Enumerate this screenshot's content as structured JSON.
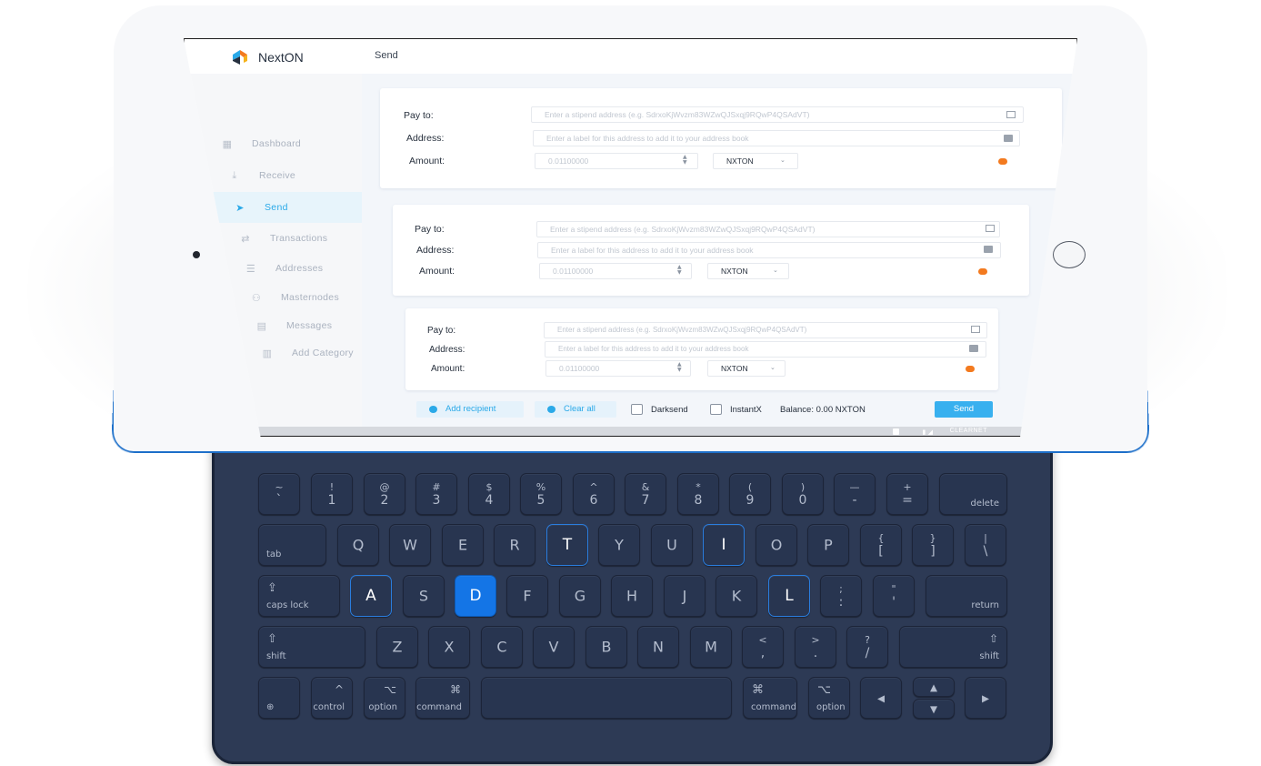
{
  "app": {
    "brand": "NextON",
    "page_title": "Send"
  },
  "sidebar": {
    "items": [
      {
        "label": "Dashboard",
        "icon": "grid-icon"
      },
      {
        "label": "Receive",
        "icon": "download-icon"
      },
      {
        "label": "Send",
        "icon": "paper-plane-icon",
        "active": true
      },
      {
        "label": "Transactions",
        "icon": "transfer-icon"
      },
      {
        "label": "Addresses",
        "icon": "contacts-icon"
      },
      {
        "label": "Masternodes",
        "icon": "nodes-icon"
      },
      {
        "label": "Messages",
        "icon": "chat-icon"
      },
      {
        "label": "Add Category",
        "icon": "chart-icon"
      }
    ]
  },
  "recipients": [
    {
      "pay_to_label": "Pay to:",
      "pay_to_placeholder": "Enter a stipend address (e.g. SdrxoKjWvzm83WZwQJSxqj9RQwP4QSAdVT)",
      "address_label": "Address:",
      "address_placeholder": "Enter a label for this address to add it to your address book",
      "amount_label": "Amount:",
      "amount_value": "0.01100000",
      "unit": "NXTON"
    },
    {
      "pay_to_label": "Pay to:",
      "pay_to_placeholder": "Enter a stipend address (e.g. SdrxoKjWvzm83WZwQJSxqj9RQwP4QSAdVT)",
      "address_label": "Address:",
      "address_placeholder": "Enter a label for this address to add it to your address book",
      "amount_label": "Amount:",
      "amount_value": "0.01100000",
      "unit": "NXTON"
    },
    {
      "pay_to_label": "Pay to:",
      "pay_to_placeholder": "Enter a stipend address (e.g. SdrxoKjWvzm83WZwQJSxqj9RQwP4QSAdVT)",
      "address_label": "Address:",
      "address_placeholder": "Enter a label for this address to add it to your address book",
      "amount_label": "Amount:",
      "amount_value": "0.01100000",
      "unit": "NXTON"
    }
  ],
  "footer": {
    "add_recipient": "Add recipient",
    "clear_all": "Clear all",
    "darksend": "Darksend",
    "instantx": "InstantX",
    "balance": "Balance: 0.00 NXTON",
    "send": "Send"
  },
  "statusbar": {
    "network": "CLEARNET"
  },
  "colors": {
    "accent": "#2aa9e8",
    "remove": "#f37a1f",
    "tablet": "#2a82dc",
    "keyboard": "#2d3a55",
    "key_highlight": "#1475e6"
  },
  "keyboard": {
    "row1": [
      {
        "t": "~",
        "b": "`"
      },
      {
        "t": "!",
        "b": "1"
      },
      {
        "t": "@",
        "b": "2"
      },
      {
        "t": "#",
        "b": "3"
      },
      {
        "t": "$",
        "b": "4"
      },
      {
        "t": "%",
        "b": "5"
      },
      {
        "t": "^",
        "b": "6"
      },
      {
        "t": "&",
        "b": "7"
      },
      {
        "t": "*",
        "b": "8"
      },
      {
        "t": "(",
        "b": "9"
      },
      {
        "t": ")",
        "b": "0"
      },
      {
        "t": "—",
        "b": "-"
      },
      {
        "t": "+",
        "b": "="
      },
      {
        "label": "delete"
      }
    ],
    "row2": [
      "tab",
      "Q",
      "W",
      "E",
      "R",
      "T",
      "Y",
      "U",
      "I",
      "O",
      "P",
      "{ [",
      "} ]",
      "| \\"
    ],
    "row3": [
      "caps lock",
      "A",
      "S",
      "D",
      "F",
      "G",
      "H",
      "J",
      "K",
      "L",
      "; :",
      "\" '",
      "return"
    ],
    "row4": [
      "shift",
      "Z",
      "X",
      "C",
      "V",
      "B",
      "N",
      "M",
      "< ,",
      "> .",
      "? /",
      "shift"
    ],
    "mods": {
      "globe": "globe-icon",
      "control": "control",
      "option": "option",
      "command": "command",
      "command_right": "command",
      "option_right": "option"
    },
    "highlighted": [
      "T",
      "I",
      "A",
      "L"
    ],
    "active": "D"
  }
}
